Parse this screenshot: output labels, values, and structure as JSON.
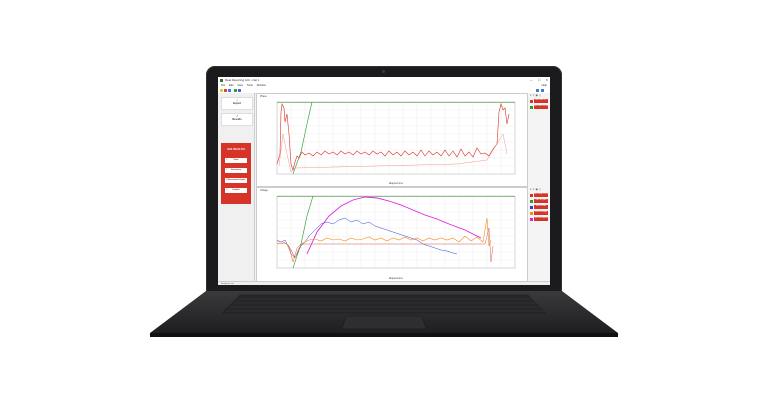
{
  "window": {
    "title": "Meat Reporting GUI - trial 1",
    "controls": [
      "—",
      "☐",
      "✕"
    ]
  },
  "menu": {
    "items": [
      "File",
      "Edit",
      "View",
      "Tools",
      "Window"
    ],
    "help": "Help"
  },
  "sidebar": {
    "import_label": "Import",
    "results_label": "Results",
    "red_panel": {
      "heading": "Infill 1B4-01 F04",
      "buttons": [
        "Data",
        "Summary",
        "F-Measurement Graphs",
        "Graphs"
      ]
    }
  },
  "graphs": {
    "top_label": "Phase",
    "bottom_label": "Voltage",
    "xaxis_label": "Elapsed time",
    "top_ticks_left": [
      "10",
      "9",
      "8",
      "7",
      "6",
      "5",
      "4",
      "3",
      "2",
      "1",
      "0",
      "-1",
      "-2",
      "-3",
      "-4",
      "-5",
      "-6",
      "-7"
    ],
    "bottom_ticks_left": [
      "7",
      "6",
      "5",
      "4",
      "3",
      "2",
      "1",
      "0",
      "-1",
      "-2",
      "-3",
      "-4",
      "-5",
      "-6",
      "-7"
    ],
    "time_ticks": [
      "00:00:00",
      "00:05:00",
      "00:10:00",
      "00:15:00",
      "00:20:00",
      "00:25:00",
      "00:30:00",
      "00:35:00",
      "00:40:00",
      "00:45:00",
      "00:50:00",
      "00:55:00",
      "01:00:00",
      "01:05:00",
      "01:10:00",
      "01:15:00",
      "01:20:00",
      "01:25:00"
    ]
  },
  "legend_top": {
    "items": [
      {
        "color": "#d63329",
        "label": "Infill Phase CH1"
      },
      {
        "color": "#2a9a2a",
        "label": "Infill Phase CH2 total"
      }
    ]
  },
  "legend_bottom": {
    "items": [
      {
        "color": "#d63329",
        "label": "Infill Voltage CH1 red"
      },
      {
        "color": "#2a9a2a",
        "label": "Infill CH2 green"
      },
      {
        "color": "#2a3ad6",
        "label": "Infill CH3 blue"
      },
      {
        "color": "#f08a20",
        "label": "Infill CH4 orange"
      },
      {
        "color": "#e020e0",
        "label": "Infill CH5 magenta"
      }
    ]
  },
  "status": {
    "text": "Ready to run"
  },
  "colors": {
    "accent": "#d63329",
    "series_red": "#d63329",
    "series_green": "#2a9a2a",
    "series_blue": "#3344dd",
    "series_orange": "#f08a20",
    "series_magenta": "#e020e0"
  }
}
